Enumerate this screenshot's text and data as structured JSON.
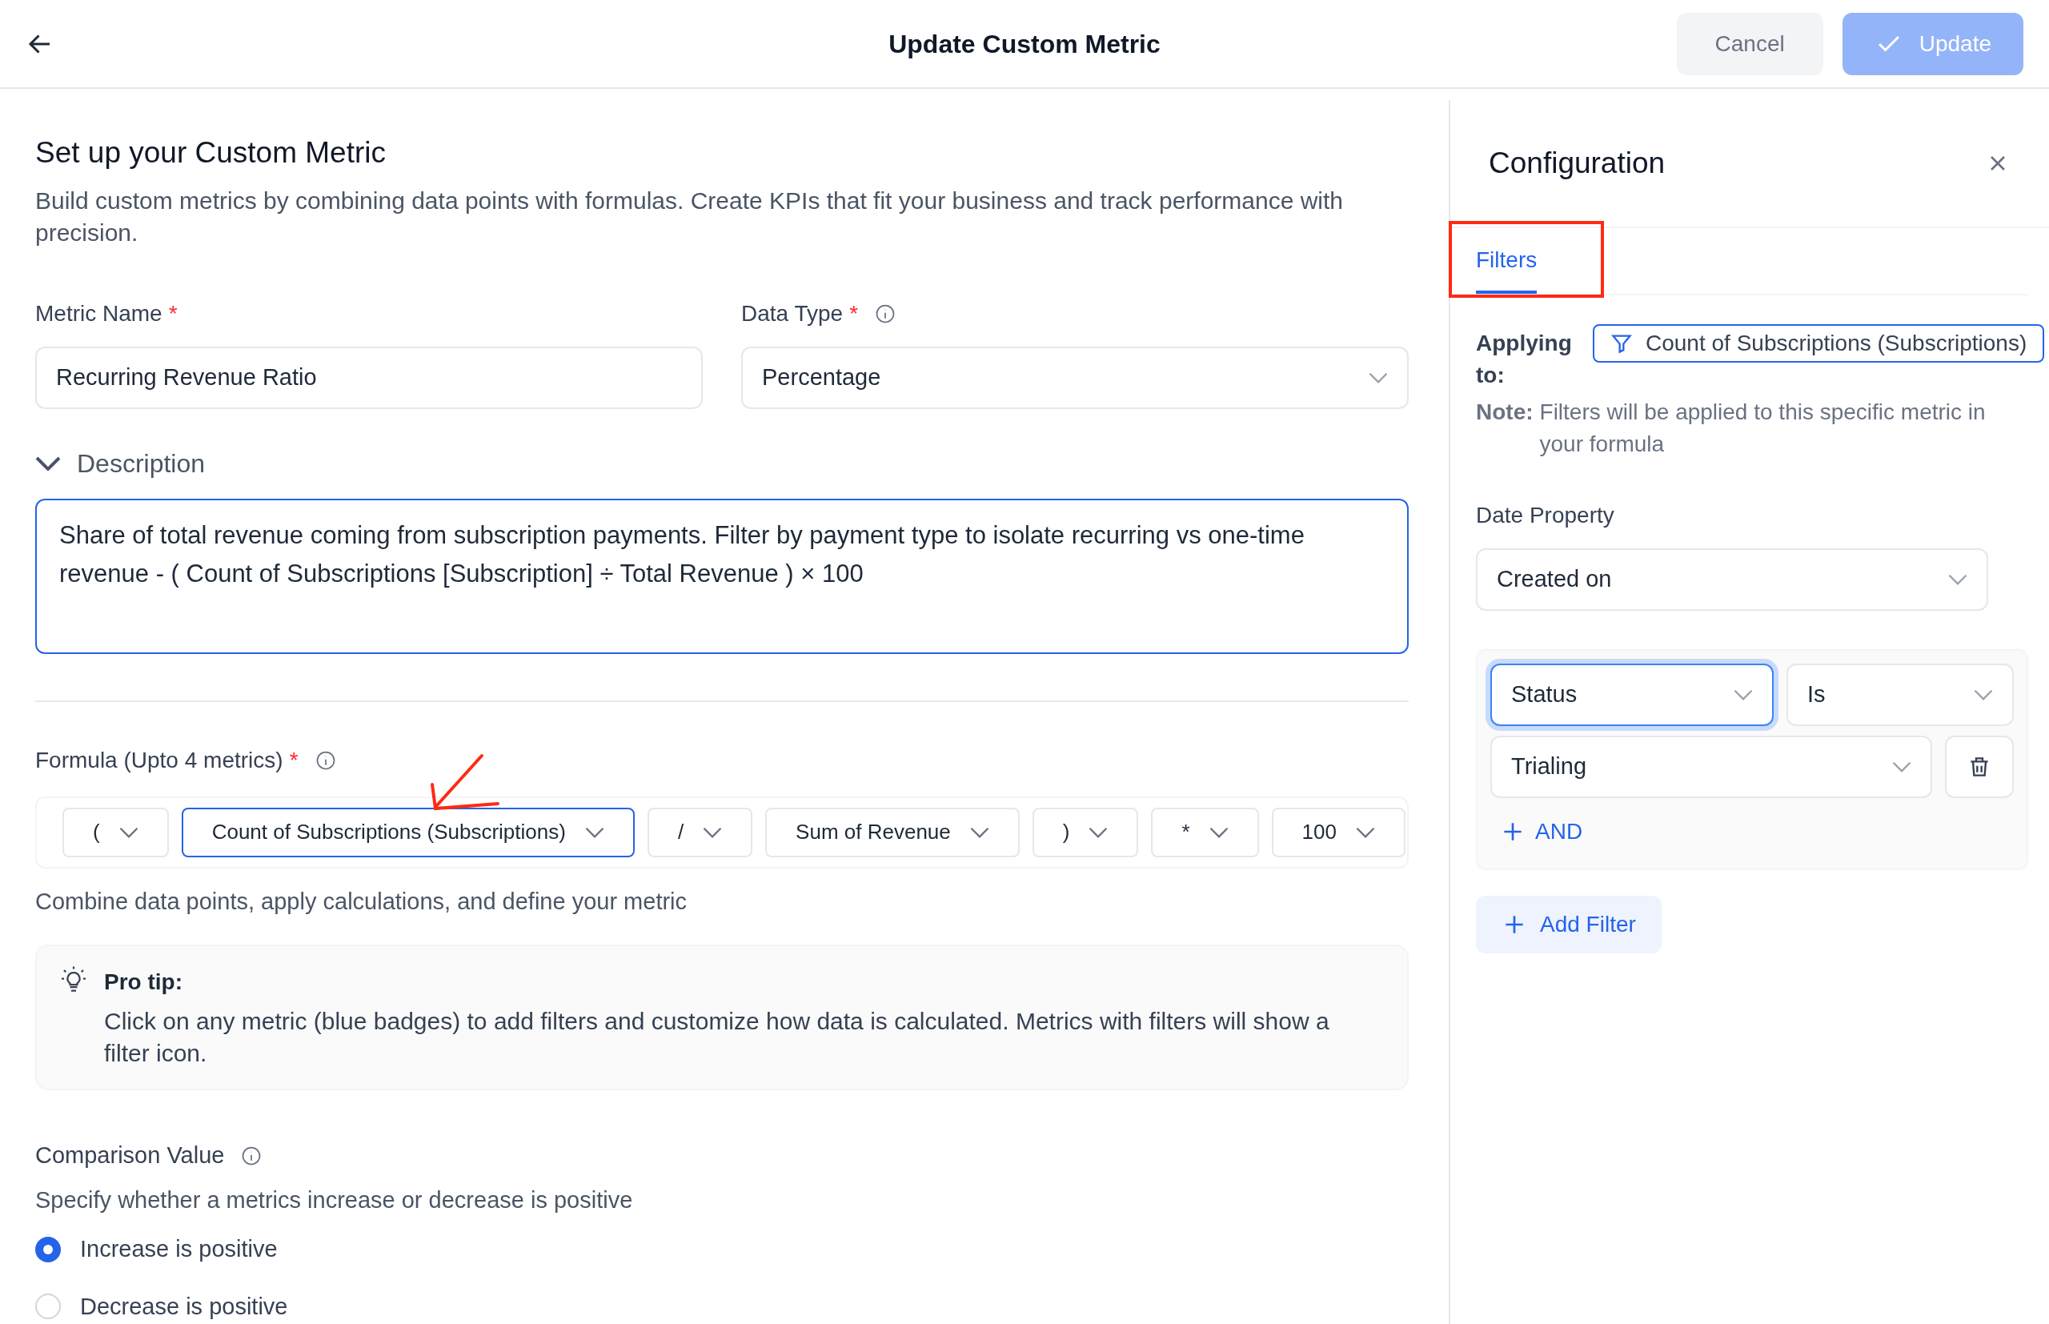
{
  "header": {
    "title": "Update Custom Metric",
    "cancel": "Cancel",
    "update": {
      "label": "Update",
      "disabled": true
    }
  },
  "main": {
    "title": "Set up your Custom Metric",
    "subtitle": "Build custom metrics by combining data points with formulas. Create KPIs that fit your business and track performance with precision.",
    "metric_name": {
      "label": "Metric Name",
      "required_mark": "*",
      "value": "Recurring Revenue Ratio"
    },
    "data_type": {
      "label": "Data Type",
      "required_mark": "*",
      "value": "Percentage"
    },
    "description": {
      "label": "Description",
      "expanded": true,
      "value": "Share of total revenue coming from subscription payments. Filter by payment type to isolate recurring vs one-time revenue - ( Count of Subscriptions [Subscription] ÷ Total Revenue ) × 100"
    },
    "formula": {
      "label": "Formula (Upto 4 metrics)",
      "required_mark": "*",
      "tokens": [
        {
          "label": "(",
          "selected": false
        },
        {
          "label": "Count of Subscriptions (Subscriptions)",
          "selected": true
        },
        {
          "label": "/",
          "selected": false
        },
        {
          "label": "Sum of Revenue",
          "selected": false
        },
        {
          "label": ")",
          "selected": false
        },
        {
          "label": "*",
          "selected": false
        },
        {
          "label": "100",
          "selected": false
        }
      ],
      "hint": "Combine data points, apply calculations, and define your metric"
    },
    "pro_tip": {
      "title": "Pro tip:",
      "text": "Click on any metric (blue badges) to add filters and customize how data is calculated. Metrics with filters will show a filter icon."
    },
    "comparison": {
      "label": "Comparison Value",
      "hint": "Specify whether a metrics increase or decrease is positive",
      "options": [
        {
          "label": "Increase is positive",
          "selected": true
        },
        {
          "label": "Decrease is positive",
          "selected": false
        }
      ]
    }
  },
  "configuration": {
    "title": "Configuration",
    "tabs": [
      {
        "label": "Filters",
        "selected": true
      }
    ],
    "applying_label": "Applying to:",
    "applying_value": "Count of Subscriptions (Subscriptions)",
    "note_label": "Note:",
    "note_text": "Filters will be applied to this specific metric in your formula",
    "date_property": {
      "label": "Date Property",
      "value": "Created on"
    },
    "filter": {
      "field": {
        "value": "Status",
        "focused": true
      },
      "operator": {
        "value": "Is",
        "focused": false
      },
      "value": {
        "value": "Trialing",
        "focused": false
      },
      "and": "AND"
    },
    "add_filter": "Add Filter"
  }
}
